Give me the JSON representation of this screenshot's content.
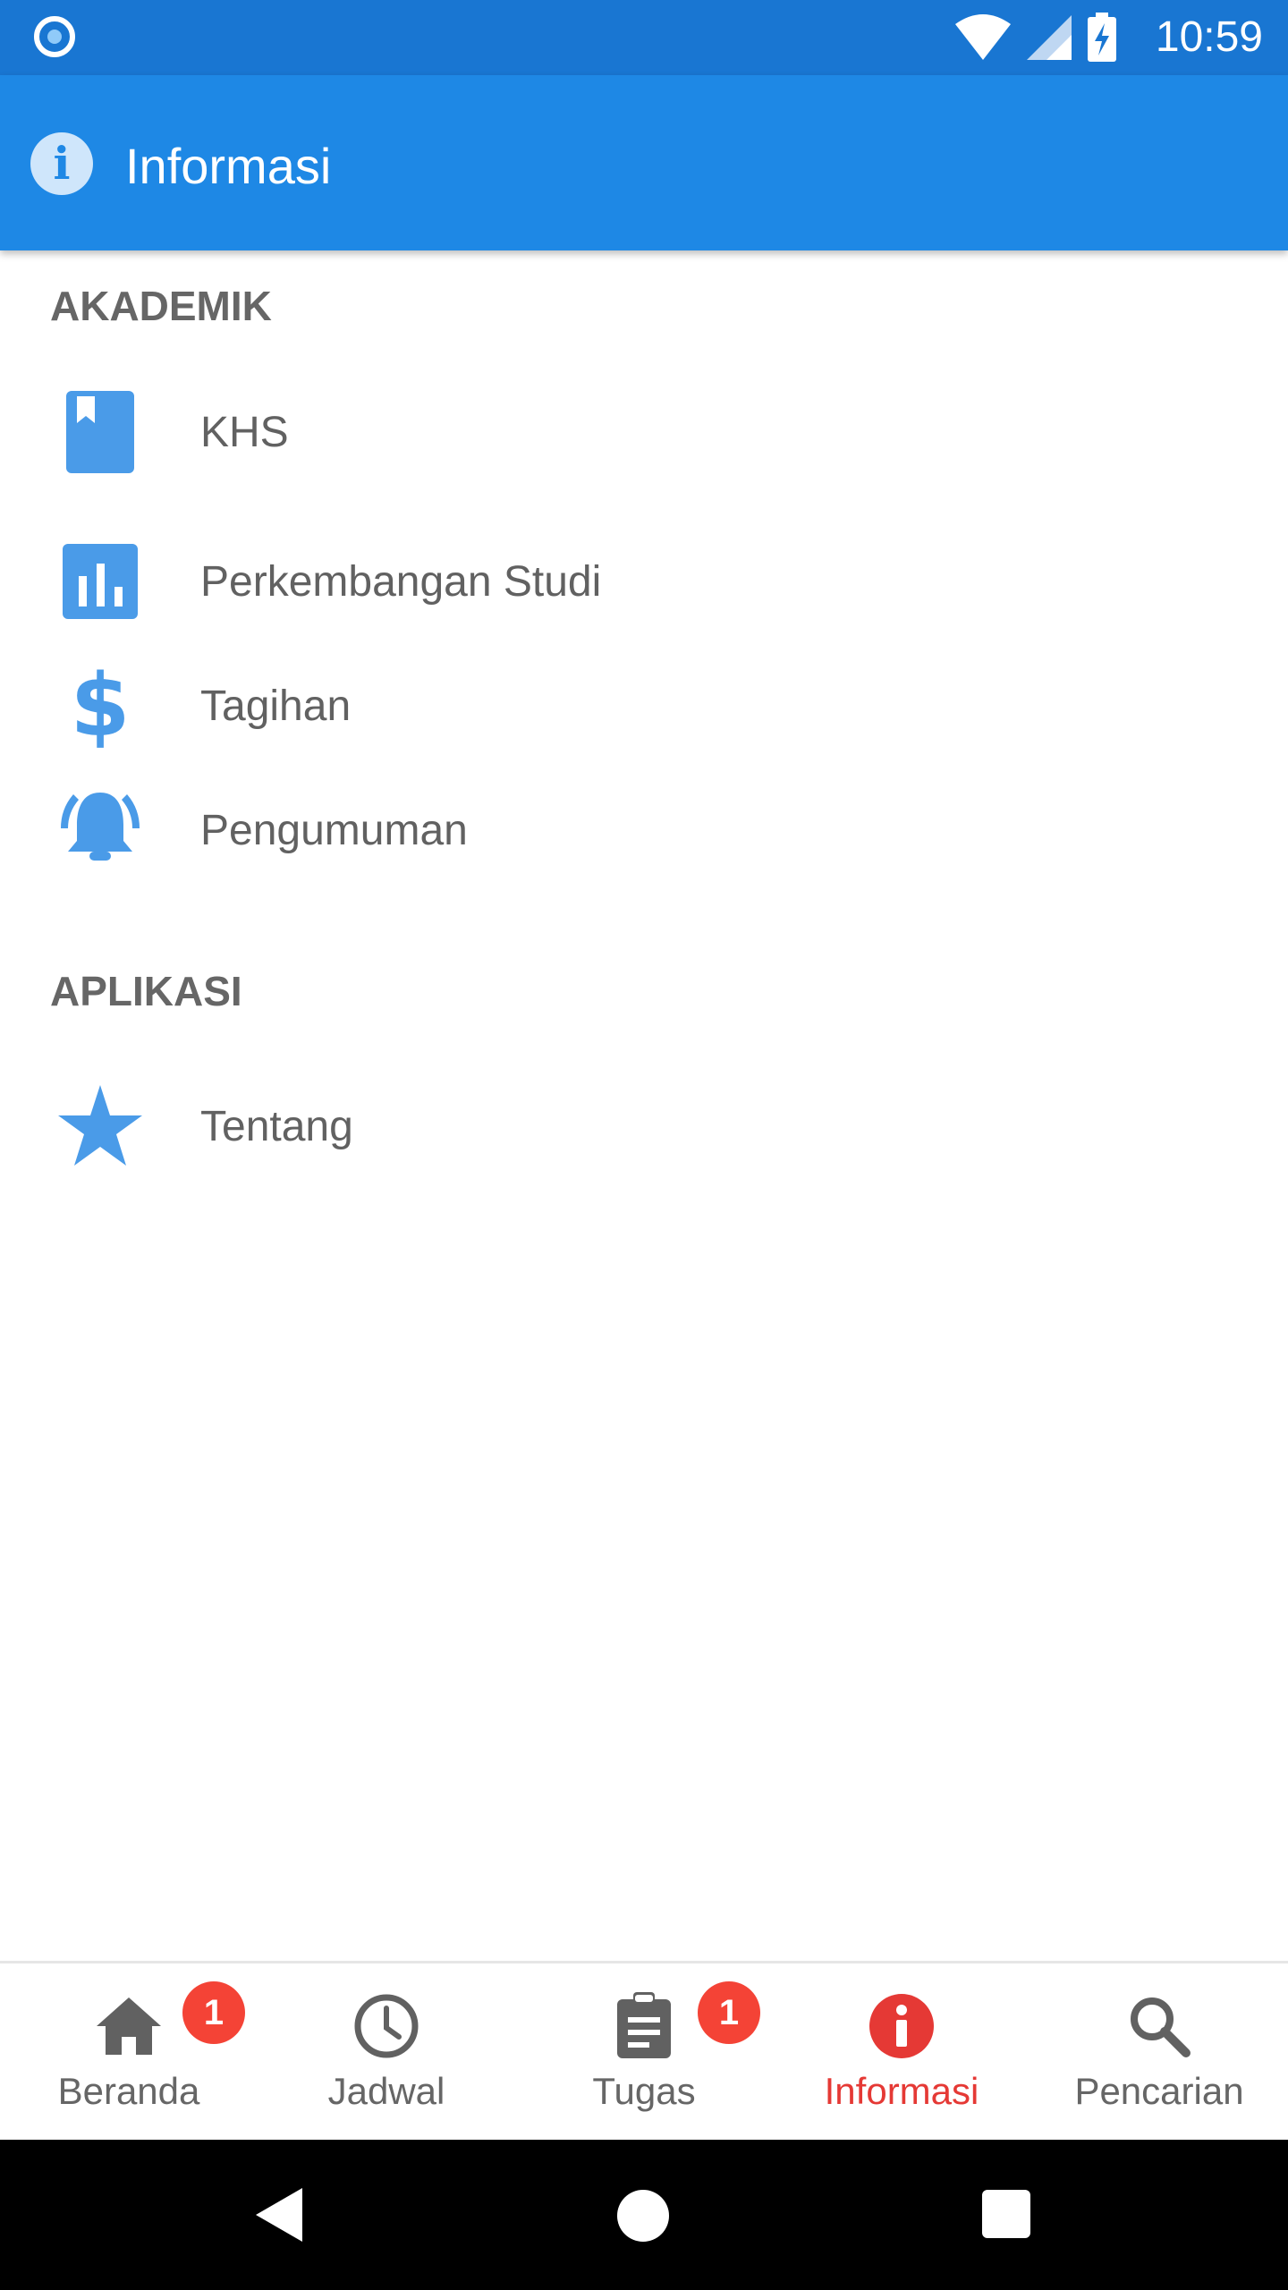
{
  "status_bar": {
    "time": "10:59"
  },
  "app_bar": {
    "title": "Informasi",
    "icon": "info-icon"
  },
  "sections": {
    "akademik": {
      "header": "AKADEMIK",
      "items": [
        {
          "label": "KHS",
          "icon": "book-icon"
        },
        {
          "label": "Perkembangan Studi",
          "icon": "bar-chart-icon"
        },
        {
          "label": "Tagihan",
          "icon": "dollar-icon"
        },
        {
          "label": "Pengumuman",
          "icon": "alarm-bell-icon"
        }
      ]
    },
    "aplikasi": {
      "header": "APLIKASI",
      "items": [
        {
          "label": "Tentang",
          "icon": "star-icon"
        }
      ]
    }
  },
  "bottom_nav": {
    "items": [
      {
        "label": "Beranda",
        "icon": "home-icon",
        "badge": "1"
      },
      {
        "label": "Jadwal",
        "icon": "clock-icon"
      },
      {
        "label": "Tugas",
        "icon": "clipboard-icon",
        "badge": "1"
      },
      {
        "label": "Informasi",
        "icon": "info-icon",
        "active": true
      },
      {
        "label": "Pencarian",
        "icon": "search-icon"
      }
    ]
  },
  "colors": {
    "status_bar": "#1976d2",
    "app_bar": "#1e88e5",
    "accent_icon": "#4a9be8",
    "active_nav": "#e53935",
    "badge": "#f44336"
  }
}
